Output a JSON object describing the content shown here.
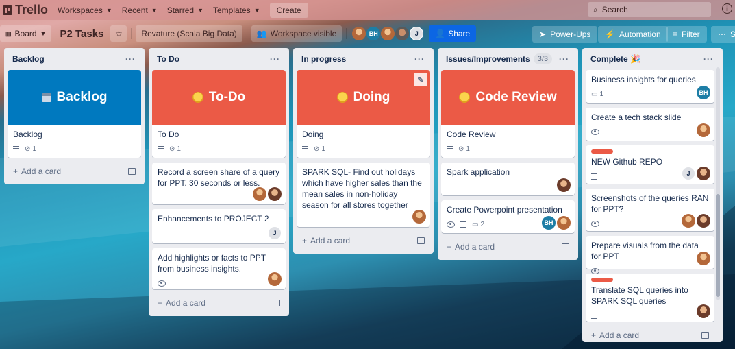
{
  "topbar": {
    "logo": "Trello",
    "nav": [
      "Workspaces",
      "Recent",
      "Starred",
      "Templates"
    ],
    "create": "Create",
    "search": "Search"
  },
  "board": {
    "view": "Board",
    "title": "P2 Tasks",
    "workspace": "Revature (Scala Big Data)",
    "visibility": "Workspace visible",
    "share": "Share",
    "powerups": "Power-Ups",
    "automation": "Automation",
    "filter": "Filter",
    "show_more": "Sh"
  },
  "lists": {
    "backlog": {
      "title": "Backlog",
      "cover_text": "Backlog",
      "cards": [
        {
          "title": "Backlog",
          "attachments": "1"
        }
      ],
      "add": "Add a card"
    },
    "todo": {
      "title": "To Do",
      "cover_text": "To-Do",
      "cards": [
        {
          "title": "To Do",
          "attachments": "1"
        },
        {
          "title": "Record a screen share of a query for PPT. 30 seconds or less."
        },
        {
          "title": "Enhancements to PROJECT 2",
          "avatar": "J"
        },
        {
          "title": "Add highlights or facts to PPT from business insights."
        }
      ],
      "add": "Add a card"
    },
    "progress": {
      "title": "In progress",
      "cover_text": "Doing",
      "cards": [
        {
          "title": "Doing",
          "attachments": "1"
        },
        {
          "title": "SPARK SQL- Find out holidays which have higher sales than the mean sales in non-holiday season for all stores together"
        }
      ],
      "add": "Add a card"
    },
    "issues": {
      "title": "Issues/Improvements",
      "count": "3/3",
      "cover_text": "Code Review",
      "cards": [
        {
          "title": "Code Review",
          "attachments": "1"
        },
        {
          "title": "Spark application"
        },
        {
          "title": "Create Powerpoint presentation",
          "comments": "2",
          "avatar": "BH"
        }
      ],
      "add": "Add a card"
    },
    "complete": {
      "title": "Complete",
      "cards": [
        {
          "title": "Business insights for queries",
          "comments": "1",
          "avatar": "BH"
        },
        {
          "title": "Create a tech stack slide"
        },
        {
          "title": "NEW Github REPO",
          "avatar": "J"
        },
        {
          "title": "Screenshots of the queries RAN for PPT?"
        },
        {
          "title": "Prepare visuals from the data for PPT"
        },
        {
          "title": "Translate SQL queries into SPARK SQL queries"
        }
      ],
      "add": "Add a card"
    }
  },
  "members": [
    "BH",
    "J"
  ],
  "colors": {
    "accent": "#0c66e4",
    "cover_blue": "#0079bf",
    "cover_red": "#eb5a46",
    "label_red": "#eb5a46"
  }
}
